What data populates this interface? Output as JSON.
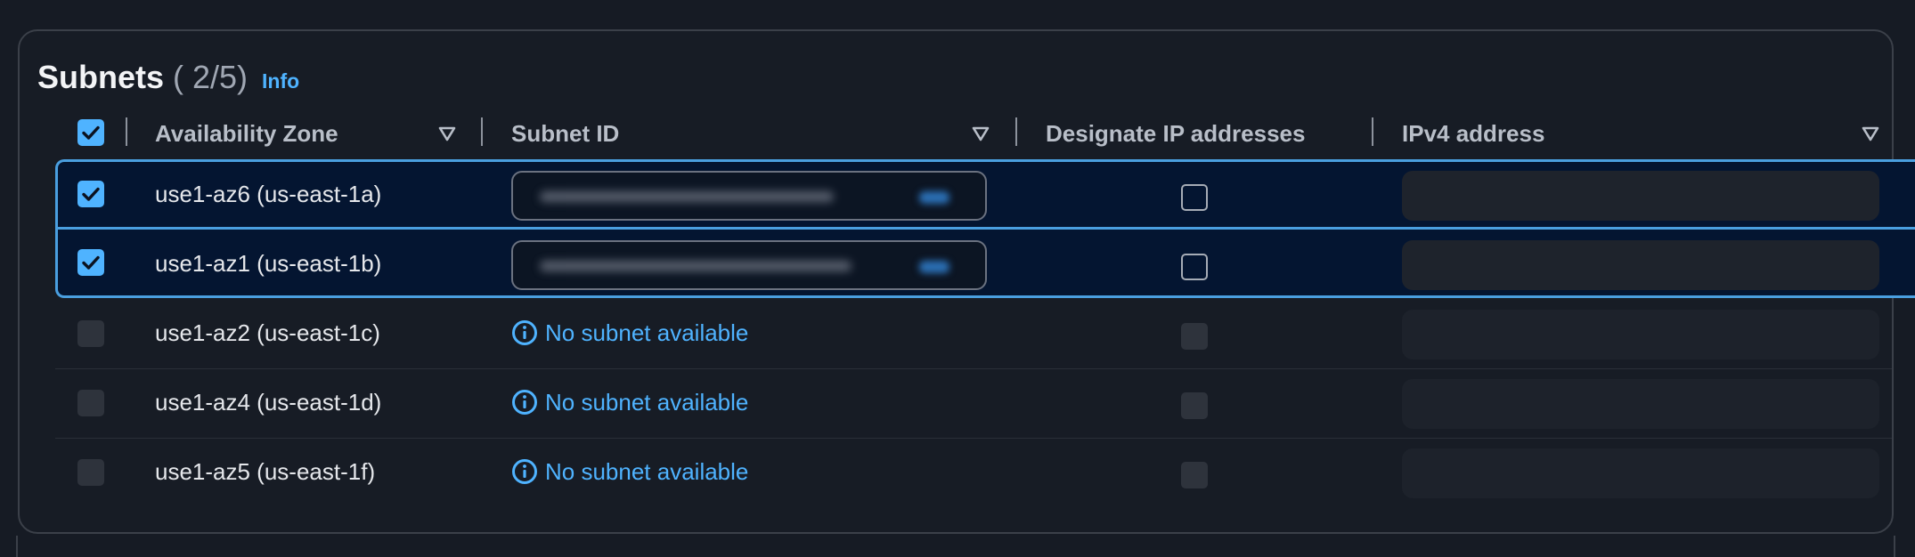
{
  "header": {
    "title": "Subnets",
    "count": "( 2/5)",
    "info_link": "Info"
  },
  "columns": [
    {
      "label": "Availability Zone",
      "sortable": true
    },
    {
      "label": "Subnet ID",
      "sortable": true
    },
    {
      "label": "Designate IP addresses",
      "sortable": false
    },
    {
      "label": "IPv4 address",
      "sortable": true
    }
  ],
  "select_all": {
    "checked": true
  },
  "rows": [
    {
      "zone": "use1-az6 (us-east-1a)",
      "selected": true,
      "subnet": "select",
      "no_subnet_text": ""
    },
    {
      "zone": "use1-az1 (us-east-1b)",
      "selected": true,
      "subnet": "select",
      "no_subnet_text": ""
    },
    {
      "zone": "use1-az2 (us-east-1c)",
      "selected": false,
      "subnet": "none",
      "no_subnet_text": "No subnet available"
    },
    {
      "zone": "use1-az4 (us-east-1d)",
      "selected": false,
      "subnet": "none",
      "no_subnet_text": "No subnet available"
    },
    {
      "zone": "use1-az5 (us-east-1f)",
      "selected": false,
      "subnet": "none",
      "no_subnet_text": "No subnet available"
    }
  ],
  "icons": {
    "checkbox_checked": "checkmark-icon",
    "sort": "sort-caret-down-icon",
    "info": "info-circle-icon"
  },
  "colors": {
    "accent": "#4fb3ff",
    "selected_row_bg": "#041531",
    "selected_row_border": "#4a9fe0",
    "panel_bg": "#171c25"
  }
}
